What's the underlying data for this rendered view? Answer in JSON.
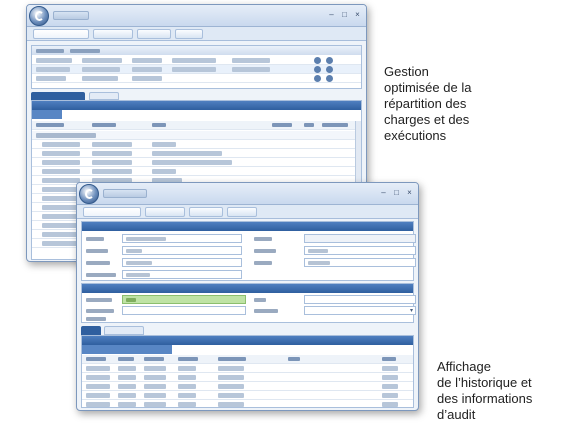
{
  "captions": {
    "top": [
      "Gestion",
      "optimisée de la",
      "répartition des",
      "charges et des",
      "exécutions"
    ],
    "bottom": [
      "Affichage",
      "de l’historique et",
      "des informations",
      "d’audit"
    ]
  },
  "colors": {
    "window_border": "#7d98bd",
    "header_blue": "#2f5f9f",
    "ribbon_bg": "#dfe9f5",
    "highlight_green": "#bfe3a5"
  },
  "icons": {
    "app_orb": "app-orb-icon",
    "window_controls": [
      "minimize-icon",
      "maximize-icon",
      "close-icon"
    ]
  }
}
